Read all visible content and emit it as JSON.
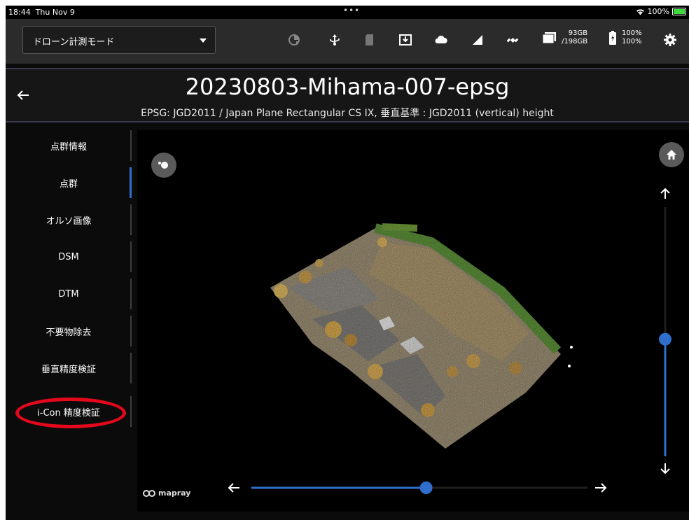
{
  "status_bar": {
    "time": "18:44",
    "date": "Thu Nov 9",
    "battery_text": "100%"
  },
  "toolbar": {
    "mode_label": "ドローン計測モード",
    "storage": {
      "free": "93GB",
      "total": "/198GB"
    },
    "battery": {
      "line1": "100%",
      "line2": "100%"
    },
    "icons": [
      "sync-alert-icon",
      "usb-icon",
      "sd-card-icon",
      "download-icon",
      "cloud-icon",
      "signal-icon",
      "satellite-icon",
      "folder-icon",
      "battery-charging-icon",
      "settings-icon"
    ]
  },
  "header": {
    "title": "20230803-Mihama-007-epsg",
    "subtitle": "EPSG: JGD2011 / Japan Plane Rectangular CS IX, 垂直基準 : JGD2011 (vertical) height"
  },
  "sidebar": {
    "items": [
      {
        "label": "点群情報",
        "active": false
      },
      {
        "label": "点群",
        "active": true
      },
      {
        "label": "オルソ画像",
        "active": false
      },
      {
        "label": "DSM",
        "active": false
      },
      {
        "label": "DTM",
        "active": false
      },
      {
        "label": "不要物除去",
        "active": false
      },
      {
        "label": "垂直精度検証",
        "active": false
      },
      {
        "label": "i-Con 精度検証",
        "active": false
      }
    ]
  },
  "viewer": {
    "logo_text": "mapray",
    "horizontal_slider_value": 0.52,
    "vertical_slider_value": 0.47
  },
  "colors": {
    "accent": "#2f6fcb",
    "annotation": "#e3081b",
    "toolbar_bg": "#2b2b2b"
  }
}
